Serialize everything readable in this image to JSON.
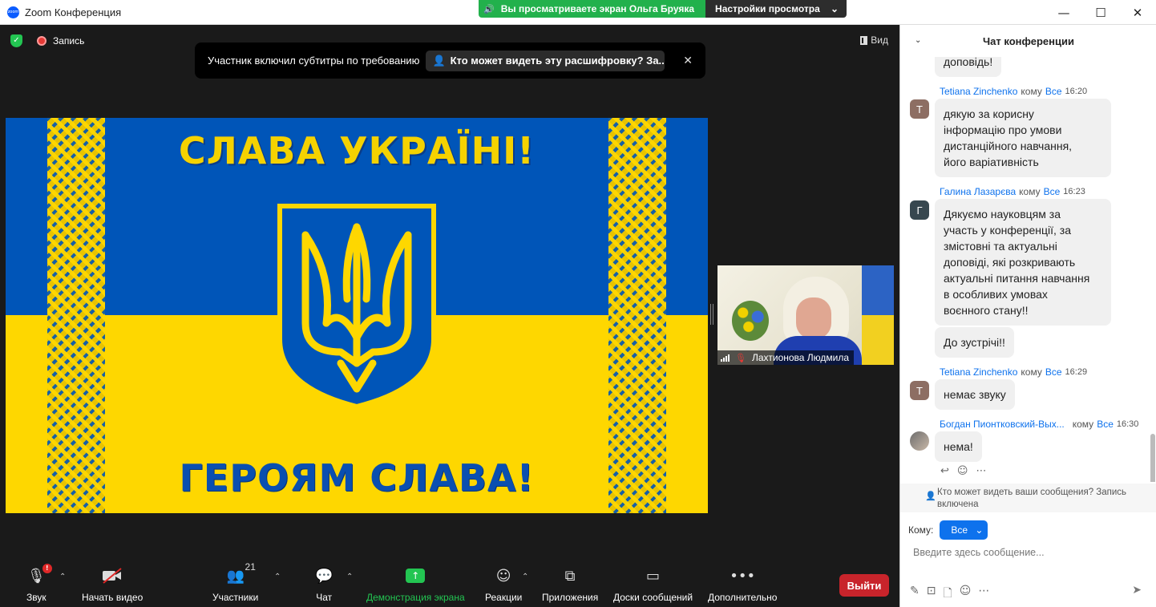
{
  "window": {
    "title": "Zoom Конференция",
    "logo_text": "zoom",
    "minimize": "—",
    "maximize": "☐",
    "close": "✕"
  },
  "share_banner": {
    "viewing_text": "Вы просматриваете экран Ольга Бруяка",
    "view_options": "Настройки просмотра"
  },
  "meeting": {
    "record_label": "Запись",
    "view_label": "Вид",
    "caption_notice": "Участник включил субтитры по требованию",
    "caption_link": "Кто может видеть эту расшифровку? За...",
    "caption_close": "✕"
  },
  "shared_screen": {
    "top_text": "СЛАВА УКРАЇНІ!",
    "bottom_text": "ГЕРОЯМ СЛАВА!",
    "colors": {
      "blue": "#0055b8",
      "yellow": "#fed700"
    }
  },
  "participant_video": {
    "name": "Лахтионова Людмила"
  },
  "toolbar": {
    "audio": "Звук",
    "audio_badge": "!",
    "video": "Начать видео",
    "participants": "Участники",
    "participants_count": "21",
    "chat": "Чат",
    "share": "Демонстрация экрана",
    "reactions": "Реакции",
    "apps": "Приложения",
    "whiteboards": "Доски сообщений",
    "more": "Дополнительно",
    "leave": "Выйти"
  },
  "chat": {
    "title": "Чат конференции",
    "partial_top": "доповідь!",
    "to_word": "кому",
    "messages": [
      {
        "avatar": "T",
        "author": "Tetiana Zinchenko",
        "to": "Все",
        "time": "16:20",
        "text": [
          "дякую за корисну",
          "інформацію про умови",
          "дистанційного навчання,",
          "його варіативність"
        ]
      },
      {
        "avatar": "Г",
        "author": "Галина Лазарєва",
        "to": "Все",
        "time": "16:23",
        "text": [
          "Дякуємо науковцям за",
          "участь у конференції, за",
          "змістовні та актуальні",
          "доповіді, які розкривають",
          "актуальні питання навчання",
          "в особливих умовах",
          "воєнного стану!!"
        ],
        "extra": "До зустрічі!!"
      },
      {
        "avatar": "T",
        "author": "Tetiana Zinchenko",
        "to": "Все",
        "time": "16:29",
        "text": [
          "немає звуку"
        ]
      },
      {
        "avatar": "",
        "author": "Богдан Пионтковский-Вых...",
        "to": "Все",
        "time": "16:30",
        "text": [
          "нема!"
        ]
      }
    ],
    "notice": "Кто может видеть ваши сообщения? Запись включена",
    "to_label": "Кому:",
    "to_value": "Все",
    "input_placeholder": "Введите здесь сообщение..."
  }
}
